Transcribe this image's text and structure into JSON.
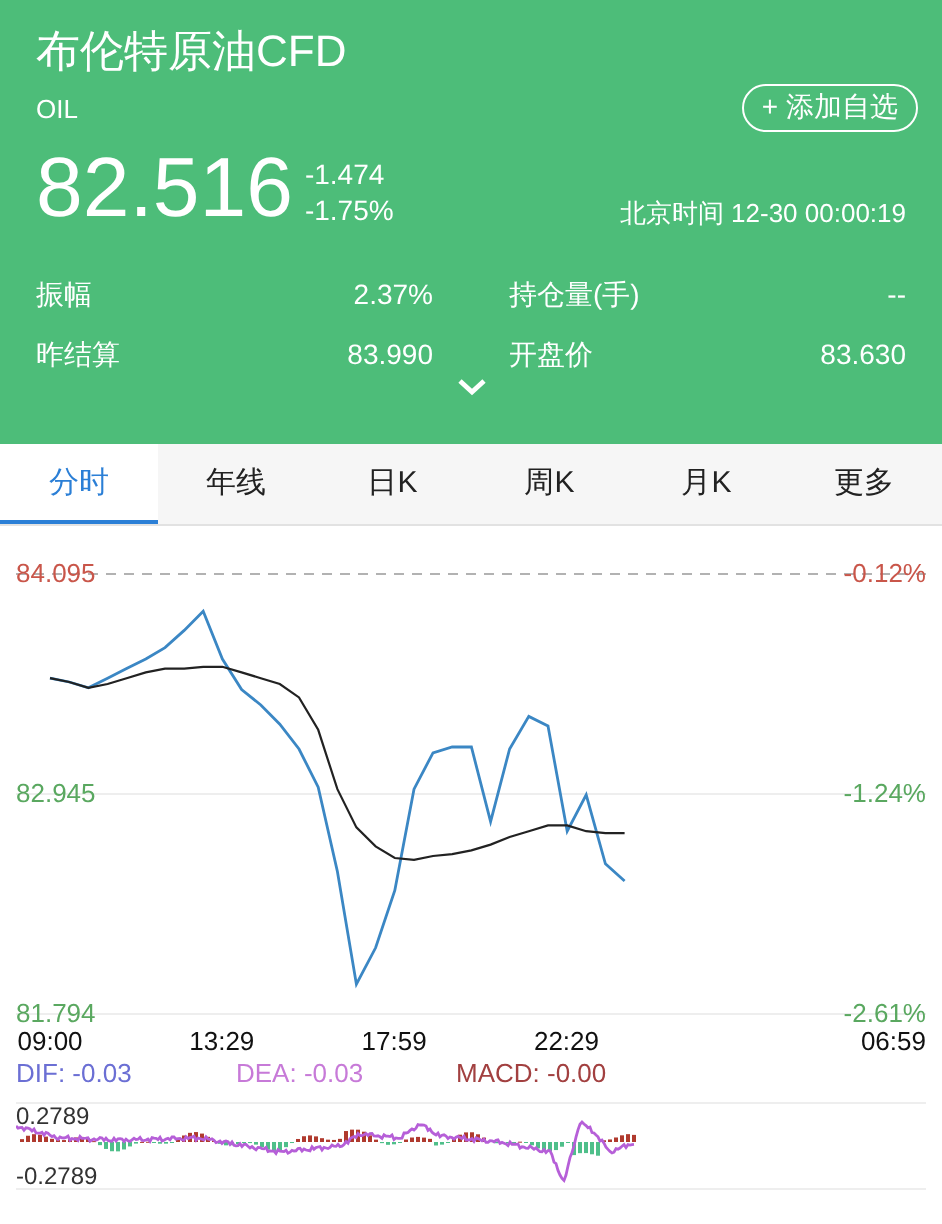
{
  "header": {
    "title": "布伦特原油CFD",
    "symbol": "OIL",
    "watch_button": "+ 添加自选",
    "price": "82.516",
    "change": "-1.474",
    "change_percent": "-1.75%",
    "time": "北京时间 12-30 00:00:19",
    "stats": [
      {
        "label": "振幅",
        "value": "2.37%"
      },
      {
        "label": "持仓量(手)",
        "value": "--"
      },
      {
        "label": "昨结算",
        "value": "83.990"
      },
      {
        "label": "开盘价",
        "value": "83.630"
      }
    ]
  },
  "tabs": [
    {
      "label": "分时",
      "selected": true
    },
    {
      "label": "年线",
      "selected": false
    },
    {
      "label": "日K",
      "selected": false
    },
    {
      "label": "周K",
      "selected": false
    },
    {
      "label": "月K",
      "selected": false
    },
    {
      "label": "更多",
      "selected": false
    }
  ],
  "chart": {
    "chart_data": {
      "type": "line",
      "x": [
        9,
        9.5,
        10,
        10.5,
        11,
        11.5,
        12,
        12.5,
        13,
        13.5,
        14,
        14.5,
        15,
        15.5,
        16,
        16.5,
        17,
        17.5,
        18,
        18.5,
        19,
        19.5,
        20,
        20.5,
        21,
        21.5,
        22,
        22.5,
        23,
        23.5,
        24
      ],
      "series": [
        {
          "color": "#3b87c4",
          "values": [
            83.55,
            83.53,
            83.5,
            83.55,
            83.6,
            83.65,
            83.71,
            83.8,
            83.9,
            83.65,
            83.49,
            83.41,
            83.31,
            83.18,
            82.98,
            82.54,
            81.95,
            82.14,
            82.44,
            82.97,
            83.16,
            83.19,
            83.19,
            82.8,
            83.18,
            83.35,
            83.3,
            82.75,
            82.94,
            82.58,
            82.49
          ]
        },
        {
          "color": "#222222",
          "values": [
            83.55,
            83.53,
            83.5,
            83.52,
            83.55,
            83.58,
            83.6,
            83.6,
            83.61,
            83.61,
            83.58,
            83.55,
            83.52,
            83.45,
            83.28,
            82.97,
            82.77,
            82.67,
            82.61,
            82.6,
            82.62,
            82.63,
            82.65,
            82.68,
            82.72,
            82.75,
            82.78,
            82.78,
            82.75,
            82.74,
            82.74
          ]
        }
      ],
      "xlim": [
        8.11,
        31.87
      ],
      "ylim": [
        81.794,
        84.095
      ],
      "xticks": [
        {
          "value": 9,
          "label": "09:00"
        },
        {
          "value": 13.483,
          "label": "13:29"
        },
        {
          "value": 17.983,
          "label": "17:59"
        },
        {
          "value": 22.483,
          "label": "22:29"
        }
      ],
      "yticks": [
        {
          "value": 84.095,
          "label": "84.095"
        },
        {
          "value": 82.945,
          "label": "82.945"
        },
        {
          "value": 81.794,
          "label": "81.794"
        }
      ]
    },
    "x_end_label": "06:59",
    "percent_labels": [
      {
        "text": "-0.12%",
        "color": "#c9564a"
      },
      {
        "text": "-1.24%",
        "color": "#5aa860"
      },
      {
        "text": "-2.61%",
        "color": "#5aa860"
      }
    ],
    "macd_legend": [
      {
        "label": "DIF: -0.03",
        "color": "#6b6fd4"
      },
      {
        "label": "DEA: -0.03",
        "color": "#c77ad8"
      },
      {
        "label": "MACD: -0.00",
        "color": "#a24040"
      }
    ],
    "macd_ticks": [
      "0.2789",
      "-0.2789"
    ]
  }
}
